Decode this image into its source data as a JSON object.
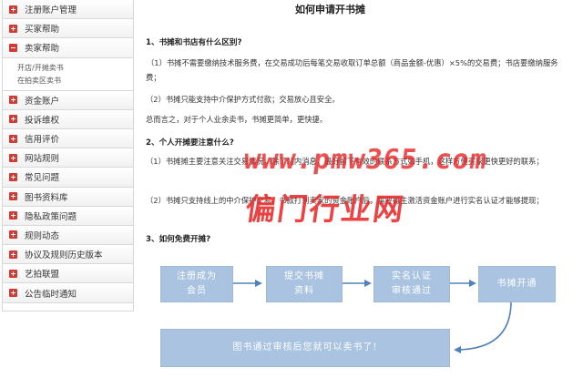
{
  "sidebar": {
    "items": [
      {
        "label": "注册账户管理",
        "open": false
      },
      {
        "label": "买家帮助",
        "open": false
      },
      {
        "label": "卖家帮助",
        "open": true,
        "sub": [
          "开店/开摊卖书",
          "在拍卖区卖书"
        ]
      },
      {
        "label": "资金账户",
        "open": false
      },
      {
        "label": "投诉维权",
        "open": false
      },
      {
        "label": "信用评价",
        "open": false
      },
      {
        "label": "网站规则",
        "open": false
      },
      {
        "label": "常见问题",
        "open": false
      },
      {
        "label": "图书资料库",
        "open": false
      },
      {
        "label": "隐私政策问题",
        "open": false
      },
      {
        "label": "规则动态",
        "open": false
      },
      {
        "label": "协议及规则历史版本",
        "open": false
      },
      {
        "label": "艺拍联盟",
        "open": false
      },
      {
        "label": "公告临时通知",
        "open": false
      }
    ]
  },
  "article": {
    "title": "如何申请开书摊",
    "h1": "1、书摊和书店有什么区别?",
    "p1": "（1）书摊不需要缴纳技术服务费，在交易成功后每笔交易收取订单总额（商品金额-优惠）×5%的交易费；书店要缴纳服务费；",
    "p2": "（2）书摊只能支持中介保护方式付款；交易放心且安全。",
    "p3": "总而言之，对于个人业余卖书，书摊更简单，更快捷。",
    "h2": "2、个人开摊要注意什么?",
    "p4": "（1）书摊摊主要注意关注交易情况，除了站内消息，最好留下有效的联系方式如手机，这样方便买家更快更好的联系；",
    "p5": "（2）书摊只支持线上的中介保护交易，书款打到卖家的资金账户后，需要摊主激活资金账户进行实名认证才能够提现；",
    "h3": "3、如何免费开摊?"
  },
  "flow": {
    "step1": "注册成为\n会员",
    "step2": "提交书摊\n资料",
    "step3": "实名认证\n审核通过",
    "step4": "书摊开通",
    "final": "图书通过审核后您就可以卖书了!"
  },
  "watermark": {
    "line1": "www.pmw365.com",
    "line2": "偏门行业网"
  },
  "colors": {
    "toggle": "#d23a34",
    "flow_box": "#a9c3e0",
    "arrow": "#4f81bd",
    "watermark": "#ec2828"
  }
}
